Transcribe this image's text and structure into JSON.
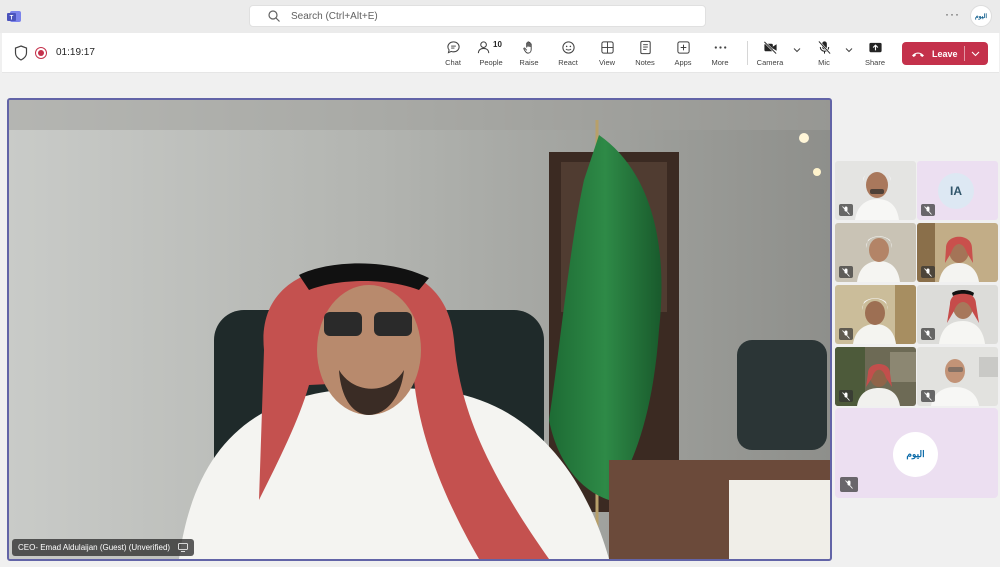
{
  "search": {
    "placeholder": "Search (Ctrl+Alt+E)"
  },
  "titlebar": {
    "more": "···",
    "avatar_text": "اليوم"
  },
  "meeting": {
    "timer": "01:19:17"
  },
  "toolbar": {
    "chat": "Chat",
    "people": "People",
    "people_count": "10",
    "raise": "Raise",
    "react": "React",
    "view": "View",
    "notes": "Notes",
    "apps": "Apps",
    "more": "More",
    "camera": "Camera",
    "mic": "Mic",
    "share": "Share",
    "leave": "Leave"
  },
  "stage": {
    "speaker_name": "CEO- Emad Aldulaijan (Guest) (Unverified)"
  },
  "gallery": {
    "ia_initials": "IA",
    "alyaum_label": "اليوم"
  },
  "colors": {
    "accent": "#6264a7",
    "leave": "#c4314b"
  }
}
